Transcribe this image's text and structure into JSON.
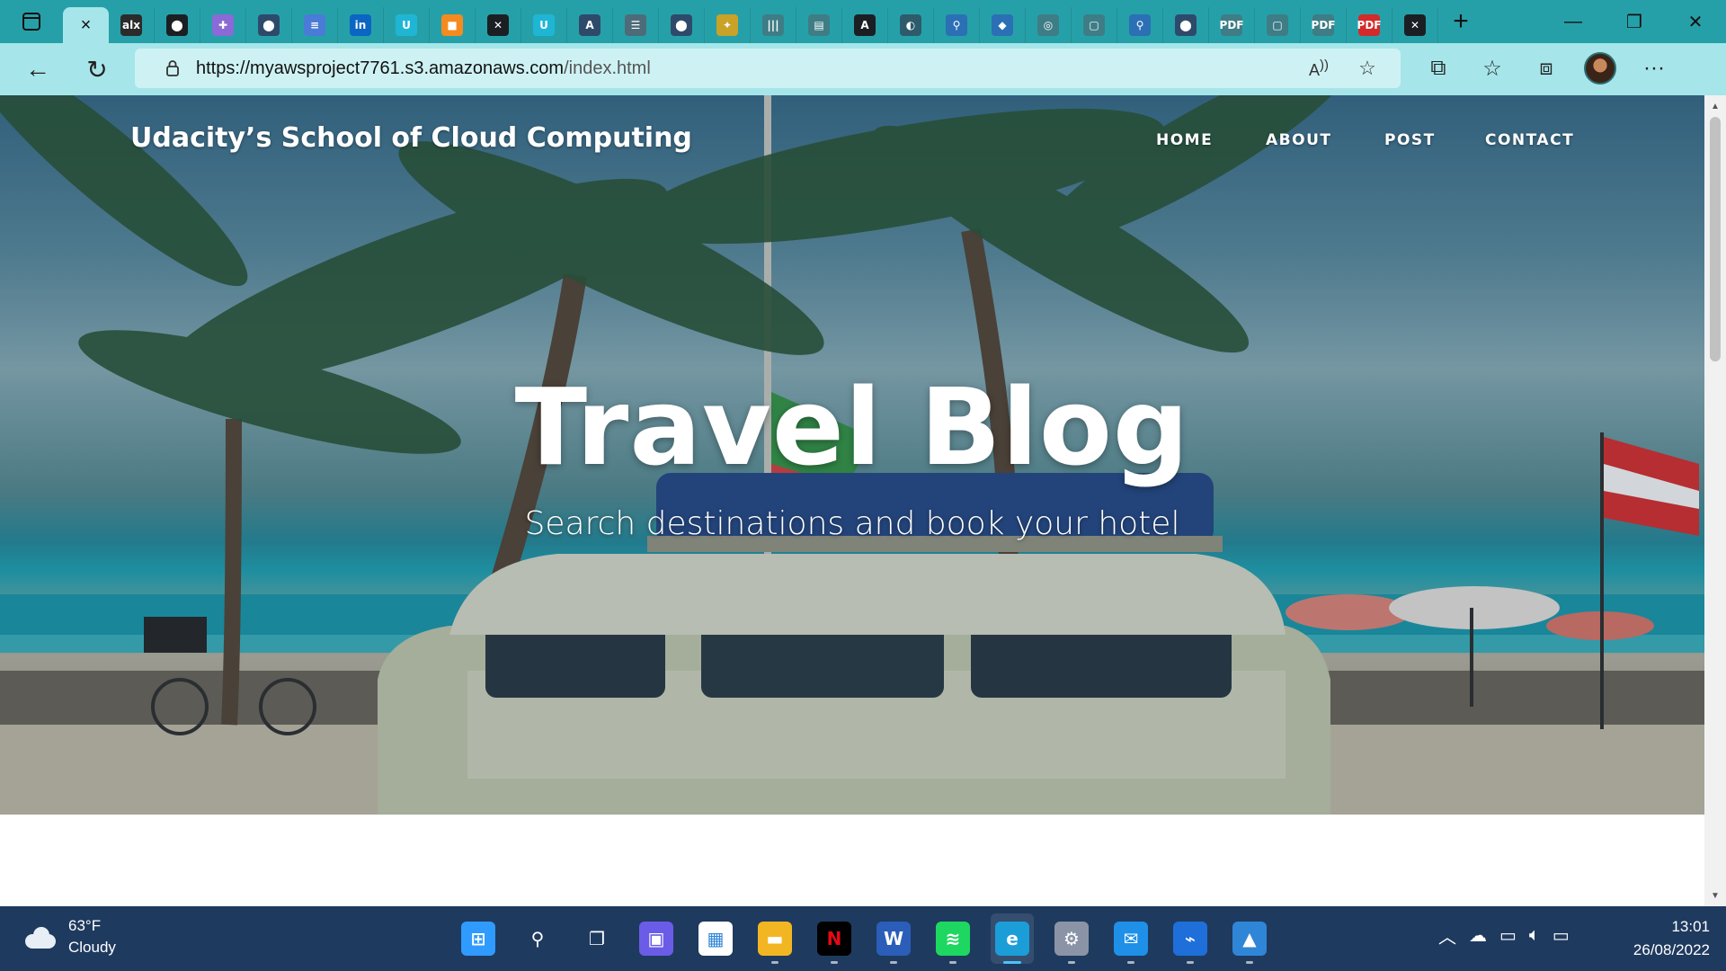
{
  "browser": {
    "tabs": [
      {
        "icon": "active-tab-icon",
        "label": "×",
        "color": "#111111",
        "active": true
      },
      {
        "icon": "alx-icon",
        "label": "alx",
        "color": "#2b2b2b"
      },
      {
        "icon": "github-icon",
        "label": "⬤",
        "color": "#1b1f23"
      },
      {
        "icon": "slack-icon",
        "label": "✚",
        "color": "#8a6ad6"
      },
      {
        "icon": "github-icon",
        "label": "⬤",
        "color": "#2e4a6b"
      },
      {
        "icon": "docs-icon",
        "label": "≡",
        "color": "#4a7bd6"
      },
      {
        "icon": "linkedin-icon",
        "label": "in",
        "color": "#0a66c2"
      },
      {
        "icon": "udacity-icon",
        "label": "U",
        "color": "#1fb6d6"
      },
      {
        "icon": "aws-cube-icon",
        "label": "■",
        "color": "#f58a1f"
      },
      {
        "icon": "xbox-icon",
        "label": "✕",
        "color": "#1b1f23"
      },
      {
        "icon": "udacity-icon",
        "label": "U",
        "color": "#1fb6d6"
      },
      {
        "icon": "aws-icon",
        "label": "A",
        "color": "#2e4a6b"
      },
      {
        "icon": "robot-icon",
        "label": "☰",
        "color": "#4d6b78"
      },
      {
        "icon": "github-icon",
        "label": "⬤",
        "color": "#2e4a6b"
      },
      {
        "icon": "badge-icon",
        "label": "✦",
        "color": "#c9a227"
      },
      {
        "icon": "cisco-icon",
        "label": "|||",
        "color": "#3e7d86"
      },
      {
        "icon": "cisco-icon",
        "label": "▤",
        "color": "#3e7d86"
      },
      {
        "icon": "font-icon",
        "label": "A",
        "color": "#1b1f23"
      },
      {
        "icon": "edge-icon",
        "label": "◐",
        "color": "#2e5b6b"
      },
      {
        "icon": "search-icon",
        "label": "⚲",
        "color": "#2b6fb5"
      },
      {
        "icon": "app-icon",
        "label": "◆",
        "color": "#2b6fb5"
      },
      {
        "icon": "app-icon",
        "label": "◎",
        "color": "#3e7d86"
      },
      {
        "icon": "page-icon",
        "label": "▢",
        "color": "#3e7d86"
      },
      {
        "icon": "search-icon",
        "label": "⚲",
        "color": "#2b6fb5"
      },
      {
        "icon": "github-icon",
        "label": "⬤",
        "color": "#2e4a6b"
      },
      {
        "icon": "pdf-icon",
        "label": "PDF",
        "color": "#3e7d86"
      },
      {
        "icon": "page-icon",
        "label": "▢",
        "color": "#3e7d86"
      },
      {
        "icon": "pdf-icon",
        "label": "PDF",
        "color": "#3e7d86"
      },
      {
        "icon": "pdf-icon",
        "label": "PDF",
        "color": "#d42a2a"
      },
      {
        "icon": "xbox-icon",
        "label": "✕",
        "color": "#1b1f23"
      }
    ],
    "url_host": "https://myawsproject7761.s3.amazonaws.com",
    "url_path": "/index.html"
  },
  "site": {
    "brand": "Udacity’s School of Cloud Computing",
    "nav": [
      "HOME",
      "ABOUT",
      "POST",
      "CONTACT"
    ],
    "title": "Travel Blog",
    "subtitle": "Search destinations and book your hotel"
  },
  "taskbar": {
    "weather_temp": "63°F",
    "weather_desc": "Cloudy",
    "apps": [
      {
        "name": "start-icon",
        "color": "#2f9bff",
        "glyph": "⊞"
      },
      {
        "name": "search-icon",
        "color": "transparent",
        "glyph": "⚲"
      },
      {
        "name": "task-view-icon",
        "color": "transparent",
        "glyph": "❐"
      },
      {
        "name": "teams-chat-icon",
        "color": "#6b5ce7",
        "glyph": "▣"
      },
      {
        "name": "store-icon",
        "color": "#ffffff",
        "glyph": "▦"
      },
      {
        "name": "file-explorer-icon",
        "color": "#f3b623",
        "glyph": "▬"
      },
      {
        "name": "netflix-icon",
        "color": "#000000",
        "glyph": "N"
      },
      {
        "name": "word-icon",
        "color": "#2b5eb8",
        "glyph": "W"
      },
      {
        "name": "spotify-icon",
        "color": "#1ed760",
        "glyph": "≋"
      },
      {
        "name": "edge-icon",
        "color": "#1b9ed8",
        "glyph": "e"
      },
      {
        "name": "settings-icon",
        "color": "#8a94a6",
        "glyph": "⚙"
      },
      {
        "name": "mail-icon",
        "color": "#1e90e8",
        "glyph": "✉"
      },
      {
        "name": "app-icon",
        "color": "#1e6fd9",
        "glyph": "⌁"
      },
      {
        "name": "photos-icon",
        "color": "#2f86d6",
        "glyph": "▲"
      }
    ],
    "time": "13:01",
    "date": "26/08/2022"
  }
}
